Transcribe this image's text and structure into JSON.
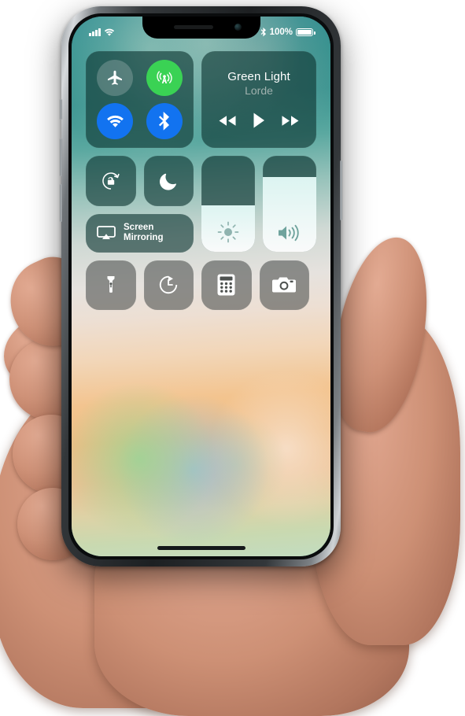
{
  "device": {
    "name": "iPhone X",
    "notch": {
      "speaker": "earpiece-speaker",
      "camera": "front-camera"
    }
  },
  "status_bar": {
    "signal_icon": "cellular-signal-bars-icon",
    "signal_bars": 4,
    "wifi_icon": "wifi-icon",
    "bluetooth_icon": "bluetooth-icon",
    "battery_percent": "100%",
    "battery_icon": "battery-full-icon",
    "battery_level": 100
  },
  "control_center": {
    "connectivity": {
      "airplane": {
        "label": "Airplane Mode",
        "icon": "airplane-icon",
        "state": "off",
        "color": "#aebebe"
      },
      "cellular": {
        "label": "Cellular Data",
        "icon": "cellular-antenna-icon",
        "state": "on",
        "color": "#3ad254"
      },
      "wifi": {
        "label": "Wi-Fi",
        "icon": "wifi-icon",
        "state": "on",
        "color": "#1273f0"
      },
      "bluetooth": {
        "label": "Bluetooth",
        "icon": "bluetooth-icon",
        "state": "on",
        "color": "#1273f0"
      }
    },
    "now_playing": {
      "title": "Green Light",
      "artist": "Lorde",
      "rewind_icon": "rewind-icon",
      "play_icon": "play-icon",
      "forward_icon": "fast-forward-icon",
      "playing": false
    },
    "rotation_lock": {
      "label": "Portrait Orientation Lock",
      "icon": "rotation-lock-icon",
      "state": "off"
    },
    "do_not_disturb": {
      "label": "Do Not Disturb",
      "icon": "moon-icon",
      "state": "off"
    },
    "screen_mirroring": {
      "label_line1": "Screen",
      "label_line2": "Mirroring",
      "icon": "airplay-screen-icon"
    },
    "brightness": {
      "label": "Brightness",
      "icon": "brightness-sun-icon",
      "value": 48
    },
    "volume": {
      "label": "Volume",
      "icon": "volume-speaker-icon",
      "value": 78
    },
    "utilities": [
      {
        "label": "Flashlight",
        "icon": "flashlight-icon"
      },
      {
        "label": "Timer",
        "icon": "timer-icon"
      },
      {
        "label": "Calculator",
        "icon": "calculator-icon"
      },
      {
        "label": "Camera",
        "icon": "camera-icon"
      }
    ]
  },
  "home_indicator": {
    "name": "home-indicator-bar"
  },
  "colors": {
    "module_background": "#0c3430",
    "accent_green": "#3ad254",
    "accent_blue": "#1273f0",
    "text_primary": "#ffffff",
    "text_secondary": "#9fb1ae"
  }
}
